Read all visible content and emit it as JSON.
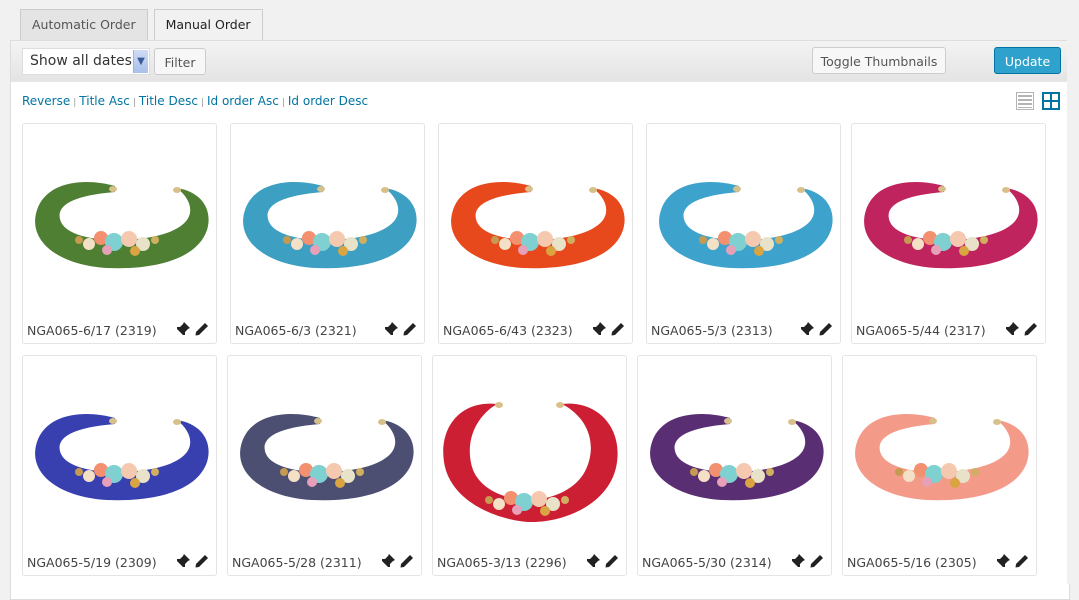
{
  "tabs": [
    {
      "label": "Automatic Order",
      "active": false
    },
    {
      "label": "Manual Order",
      "active": true
    }
  ],
  "toolbar": {
    "date_filter": {
      "selected": "Show all dates"
    },
    "filter_label": "Filter",
    "toggle_thumbnails_label": "Toggle Thumbnails",
    "update_label": "Update"
  },
  "sort_links": [
    "Reverse",
    "Title Asc",
    "Title Desc",
    "Id order Asc",
    "Id order Desc"
  ],
  "view_modes": [
    {
      "name": "list-view",
      "active": false
    },
    {
      "name": "grid-view",
      "active": true
    }
  ],
  "colors": {
    "accent": "#0074a2",
    "update_button": "#2ea2cc"
  },
  "items": [
    {
      "title": "NGA065-6/17 (2319)",
      "color": "#4e7f32",
      "shape": "open"
    },
    {
      "title": "NGA065-6/3 (2321)",
      "color": "#3d9fc2",
      "shape": "open"
    },
    {
      "title": "NGA065-6/43 (2323)",
      "color": "#e8491c",
      "shape": "open"
    },
    {
      "title": "NGA065-5/3 (2313)",
      "color": "#3ea3cc",
      "shape": "open"
    },
    {
      "title": "NGA065-5/44 (2317)",
      "color": "#c0245e",
      "shape": "open"
    },
    {
      "title": "NGA065-5/19 (2309)",
      "color": "#3840b0",
      "shape": "open"
    },
    {
      "title": "NGA065-5/28 (2311)",
      "color": "#4c4f72",
      "shape": "open"
    },
    {
      "title": "NGA065-3/13 (2296)",
      "color": "#cc1f34",
      "shape": "deep"
    },
    {
      "title": "NGA065-5/30 (2314)",
      "color": "#5a2e72",
      "shape": "open"
    },
    {
      "title": "NGA065-5/16 (2305)",
      "color": "#f39a88",
      "shape": "open"
    }
  ]
}
